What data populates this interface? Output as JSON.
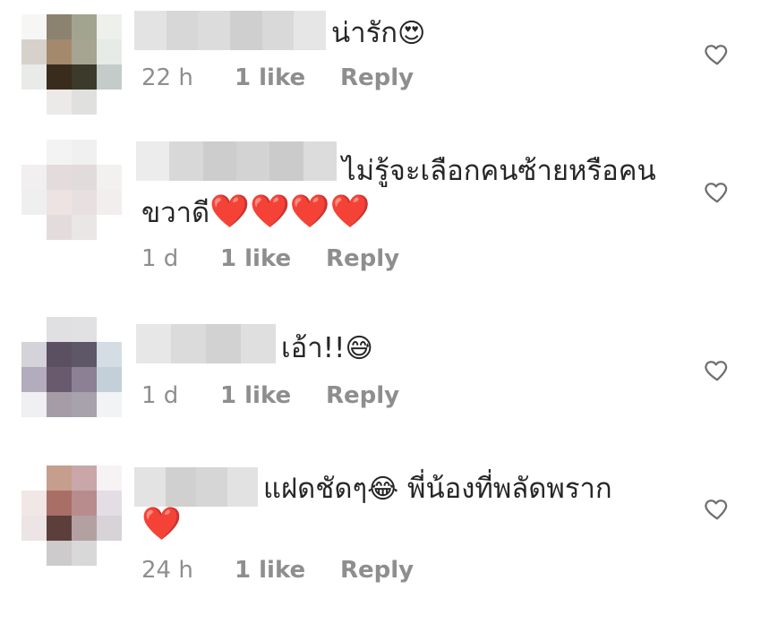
{
  "comments": [
    {
      "text": "น่ารัก",
      "emoji": "😍",
      "time": "22 h",
      "likes": "1 like",
      "reply": "Reply",
      "avatar_colors": [
        "#f6f7f5",
        "#8c8270",
        "#a3a490",
        "#eef0ec",
        "#d6d2cb",
        "#a5896c",
        "#a5a592",
        "#e6ebe8",
        "#e9ebe8",
        "#3a2c1c",
        "#3c3a2a",
        "#c4ccc9",
        "#ffffff",
        "#ebeae9",
        "#e0e0de",
        "#ffffff"
      ]
    },
    {
      "text_line1": "ไม่รู้จะเลือกคนซ้ายหรือคน",
      "text_line2": "ขวาดี",
      "hearts": [
        "❤️",
        "❤️",
        "❤️",
        "❤️"
      ],
      "time": "1 d",
      "likes": "1 like",
      "reply": "Reply",
      "avatar_colors": [
        "#ffffff",
        "#f3f3f3",
        "#f0f0f0",
        "#ffffff",
        "#f1efef",
        "#e4dcdc",
        "#e2dbdb",
        "#f3f0f0",
        "#efefef",
        "#ede3e3",
        "#e7e0e0",
        "#f2eeee",
        "#ffffff",
        "#e4dcdc",
        "#ebe6e6",
        "#ffffff"
      ]
    },
    {
      "text": "เอ้า!!",
      "emoji": "😅",
      "time": "1 d",
      "likes": "1 like",
      "reply": "Reply",
      "avatar_colors": [
        "#ffffff",
        "#e0dfe2",
        "#e1e0e3",
        "#ffffff",
        "#d4d3d9",
        "#5b4f62",
        "#5e5767",
        "#d5dde4",
        "#b3abbe",
        "#6a5a6e",
        "#8c8194",
        "#c3d0da",
        "#f0eff2",
        "#a59ca8",
        "#a8a2ad",
        "#f2f3f5"
      ]
    },
    {
      "text_part1": "แฝดชัดๆ",
      "emoji": "😂",
      "text_part2": "พี่น้องที่พลัดพราก",
      "heart": "❤️",
      "time": "24 h",
      "likes": "1 like",
      "reply": "Reply",
      "avatar_colors": [
        "#ffffff",
        "#c59e8e",
        "#c9a7a9",
        "#f7f2f4",
        "#f1e7e5",
        "#a96e66",
        "#b88c8d",
        "#e4dde6",
        "#ece4e5",
        "#5c3f3b",
        "#b3a1a2",
        "#d7d3d6",
        "#ffffff",
        "#cdcbcc",
        "#d9d8d8",
        "#ffffff"
      ]
    }
  ],
  "heart_icon_color": "#6e6e6e"
}
